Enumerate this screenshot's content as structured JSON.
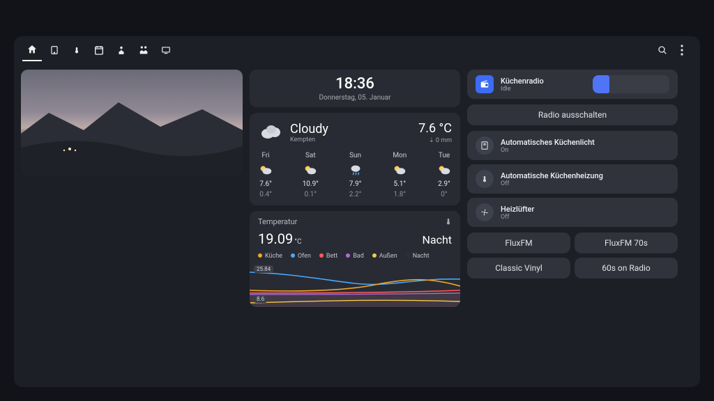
{
  "colors": {
    "accent": "#4f74f6"
  },
  "nav": {
    "items": [
      "home",
      "tablet",
      "thermometer",
      "calendar",
      "person",
      "family",
      "tv"
    ]
  },
  "clock": {
    "time": "18:36",
    "date": "Donnerstag, 05. Januar"
  },
  "weather": {
    "condition": "Cloudy",
    "location": "Kempten",
    "temp": "7.6 °C",
    "precip": "0 mm",
    "days": [
      {
        "name": "Fri",
        "icon": "partly",
        "hi": "7.6°",
        "lo": "0.4°"
      },
      {
        "name": "Sat",
        "icon": "partly",
        "hi": "10.9°",
        "lo": "0.1°"
      },
      {
        "name": "Sun",
        "icon": "rain",
        "hi": "7.9°",
        "lo": "2.2°"
      },
      {
        "name": "Mon",
        "icon": "partly",
        "hi": "5.1°",
        "lo": "1.8°"
      },
      {
        "name": "Tue",
        "icon": "partly",
        "hi": "2.9°",
        "lo": "0°"
      }
    ]
  },
  "temperature": {
    "title": "Temperatur",
    "value": "19.09",
    "unit": "°C",
    "state": "Nacht",
    "legend": [
      {
        "label": "Küche",
        "color": "#f5a623"
      },
      {
        "label": "Ofen",
        "color": "#4aa8ff"
      },
      {
        "label": "Bett",
        "color": "#ff5b5b"
      },
      {
        "label": "Bad",
        "color": "#b06bdc"
      },
      {
        "label": "Außen",
        "color": "#f5c94a"
      },
      {
        "label": "Nacht",
        "color": "#2d2f36"
      }
    ],
    "chart_tags": {
      "top": "25.84",
      "bottom": "8.6"
    }
  },
  "media": {
    "name": "Küchenradio",
    "state": "Idle",
    "off_button": "Radio ausschalten"
  },
  "devices": [
    {
      "name": "Automatisches Küchenlicht",
      "state": "On",
      "icon": "bulb-panel"
    },
    {
      "name": "Automatische Küchenheizung",
      "state": "Off",
      "icon": "thermometer"
    },
    {
      "name": "Heizlüfter",
      "state": "Off",
      "icon": "fan"
    }
  ],
  "presets": [
    "FluxFM",
    "FluxFM 70s",
    "Classic Vinyl",
    "60s on Radio"
  ],
  "chart_data": {
    "type": "line",
    "title": "Temperatur",
    "ylabel": "°C",
    "xlabel": "",
    "ylim": [
      8.6,
      25.84
    ],
    "x_extent_hours": 24,
    "series": [
      {
        "name": "Küche",
        "color": "#f5a623",
        "values": [
          18.2,
          18.0,
          17.8,
          17.6,
          18.5,
          20.0,
          22.5,
          21.0,
          19.5,
          19.1
        ]
      },
      {
        "name": "Ofen",
        "color": "#4aa8ff",
        "values": [
          24.0,
          23.0,
          21.5,
          20.0,
          19.0,
          18.5,
          18.0,
          19.5,
          22.0,
          20.0
        ]
      },
      {
        "name": "Bett",
        "color": "#ff5b5b",
        "values": [
          17.5,
          17.4,
          17.3,
          17.2,
          17.2,
          17.1,
          17.1,
          17.2,
          17.8,
          18.0
        ]
      },
      {
        "name": "Bad",
        "color": "#b06bdc",
        "values": [
          17.0,
          17.0,
          16.9,
          16.8,
          16.8,
          16.7,
          16.8,
          17.0,
          17.3,
          17.4
        ]
      },
      {
        "name": "Außen",
        "color": "#f5c94a",
        "values": [
          8.6,
          9.0,
          9.5,
          10.0,
          11.0,
          12.0,
          11.5,
          10.0,
          9.0,
          8.8
        ]
      },
      {
        "name": "Nacht",
        "color": "#2d2f36",
        "values": [
          1,
          1,
          1,
          1,
          0,
          0,
          0,
          0,
          1,
          1
        ]
      }
    ]
  }
}
